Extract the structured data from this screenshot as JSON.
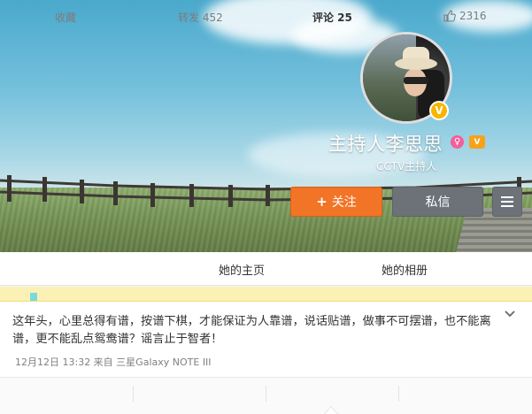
{
  "profile": {
    "nickname": "主持人李思思",
    "description": "CCTV主持人",
    "verified_badge": "V",
    "gender_icon": "female-icon",
    "member_icon": "vip-crown-icon",
    "member_label": "V"
  },
  "actions": {
    "follow_label": "关注",
    "follow_icon": "+",
    "message_label": "私信",
    "menu_icon": "hamburger-menu-icon"
  },
  "tabs": [
    {
      "label": "她的主页"
    },
    {
      "label": "她的相册"
    }
  ],
  "post": {
    "text": "这年头，心里总得有谱，按谱下棋，才能保证为人靠谱，说话贴谱，做事不可摆谱，也不能离谱，更不能乱点鸳鸯谱？谣言止于智者！",
    "meta": "12月12日  13:32 来自 三星Galaxy NOTE III",
    "expand_icon": "chevron-down-icon"
  },
  "post_actions": {
    "favorite_label": "收藏",
    "repost_label": "转发 452",
    "comment_label": "评论 25",
    "like_count": "2316",
    "like_icon": "thumbs-up-icon"
  },
  "colors": {
    "follow_button": "#f27426",
    "secondary_button": "#6d7278",
    "notice_bar": "#fbf1b4"
  }
}
